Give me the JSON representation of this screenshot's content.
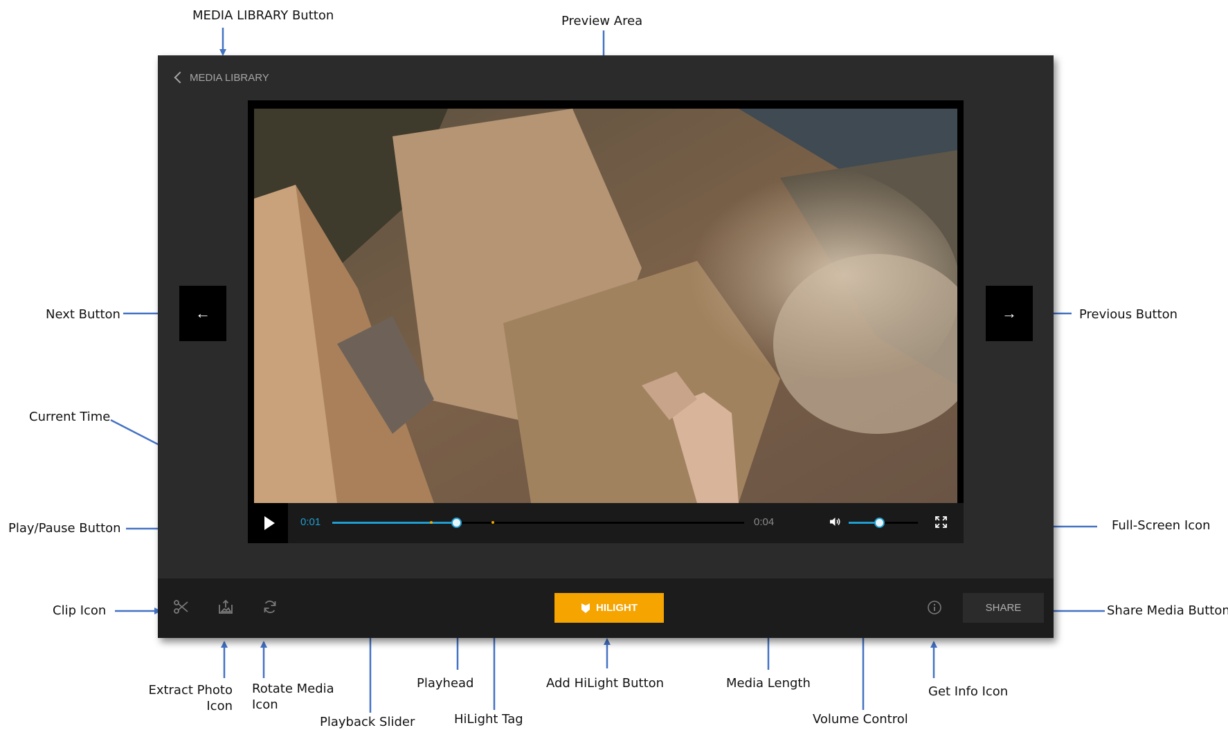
{
  "annotations": {
    "media_library_button": "MEDIA LIBRARY Button",
    "preview_area": "Preview Area",
    "next_button": "Next Button",
    "previous_button": "Previous Button",
    "current_time": "Current Time",
    "play_pause_button": "Play/Pause Button",
    "full_screen_icon": "Full-Screen Icon",
    "clip_icon": "Clip Icon",
    "share_media_button": "Share Media Button",
    "extract_photo_icon": "Extract Photo Icon",
    "rotate_media_icon": "Rotate Media Icon",
    "playback_slider": "Playback Slider",
    "playhead": "Playhead",
    "hilight_tag": "HiLight Tag",
    "add_hilight_button": "Add HiLight Button",
    "media_length": "Media Length",
    "volume_control": "Volume Control",
    "get_info_icon": "Get Info Icon"
  },
  "app": {
    "back_label": "MEDIA LIBRARY",
    "nav_prev_icon": "left-arrow-icon",
    "nav_prev_glyph": "←",
    "nav_next_icon": "right-arrow-icon",
    "nav_next_glyph": "→",
    "player": {
      "current_time": "0:01",
      "media_length": "0:04",
      "progress_fraction": 0.3,
      "buffered_fraction": 0.24,
      "hilight_tags": [
        0.39
      ],
      "volume_fraction": 0.44
    },
    "toolbar": {
      "hilight_label": "HILIGHT",
      "share_label": "SHARE",
      "icons": [
        "scissors-icon",
        "extract-photo-icon",
        "rotate-icon",
        "info-icon"
      ]
    },
    "colors": {
      "accent": "#1f9ecf",
      "hilight": "#f5a400",
      "background": "#2b2b2b",
      "toolbar": "#1c1c1c",
      "annotation_arrow": "#4472c4"
    }
  }
}
